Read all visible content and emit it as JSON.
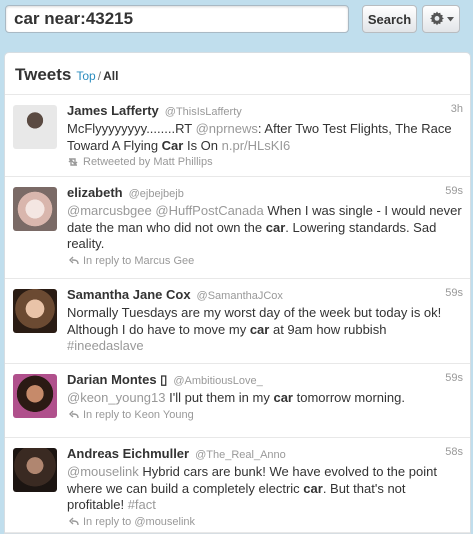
{
  "search": {
    "query": "car near:43215",
    "button_label": "Search"
  },
  "panel": {
    "title": "Tweets",
    "filter_top": "Top",
    "filter_sep": "/",
    "filter_all": "All"
  },
  "tweets": [
    {
      "name": "James Lafferty",
      "handle": "@ThisIsLafferty",
      "time": "3h",
      "text": [
        {
          "t": "McFlyyyyyyyy........RT "
        },
        {
          "t": "@nprnews",
          "c": "mention"
        },
        {
          "t": ": After Two Test Flights, The Race Toward A Flying "
        },
        {
          "t": "Car",
          "c": "kw"
        },
        {
          "t": " Is On "
        },
        {
          "t": "n.pr/HLsKI6",
          "c": "link"
        }
      ],
      "meta": "Retweeted by Matt Phillips",
      "meta_icon": "retweet-icon"
    },
    {
      "name": "elizabeth",
      "handle": "@ejbejbejb",
      "time": "59s",
      "text": [
        {
          "t": "@marcusbgee",
          "c": "mention"
        },
        {
          "t": " "
        },
        {
          "t": "@HuffPostCanada",
          "c": "mention"
        },
        {
          "t": " When I was single - I would never date the man who did not own the "
        },
        {
          "t": "car",
          "c": "kw"
        },
        {
          "t": ". Lowering standards. Sad reality."
        }
      ],
      "meta": "In reply to Marcus Gee",
      "meta_icon": "reply-icon"
    },
    {
      "name": "Samantha Jane Cox",
      "handle": "@SamanthaJCox",
      "time": "59s",
      "text": [
        {
          "t": "Normally Tuesdays are my worst day of the week but today is ok! Although I do have to move my "
        },
        {
          "t": "car",
          "c": "kw"
        },
        {
          "t": " at 9am how rubbish "
        },
        {
          "t": "#ineedaslave",
          "c": "mention"
        }
      ],
      "meta": "",
      "meta_icon": ""
    },
    {
      "name": "Darian Montes ▯",
      "handle": "@AmbitiousLove_",
      "time": "59s",
      "text": [
        {
          "t": "@keon_young13",
          "c": "mention"
        },
        {
          "t": " I'll put them in my "
        },
        {
          "t": "car",
          "c": "kw"
        },
        {
          "t": " tomorrow morning."
        }
      ],
      "meta": "In reply to Keon Young",
      "meta_icon": "reply-icon"
    },
    {
      "name": "Andreas Eichmuller",
      "handle": "@The_Real_Anno",
      "time": "58s",
      "text": [
        {
          "t": "@mouselink",
          "c": "mention"
        },
        {
          "t": " Hybrid cars are bunk! We have evolved to the point where we can build a completely electric "
        },
        {
          "t": "car",
          "c": "kw"
        },
        {
          "t": ". But that's not profitable! "
        },
        {
          "t": "#fact",
          "c": "mention"
        }
      ],
      "meta": "In reply to @mouselink",
      "meta_icon": "reply-icon"
    }
  ],
  "colors": {
    "background": "#c0deed",
    "link": "#2a8cbf",
    "muted": "#999999",
    "text": "#333333"
  }
}
